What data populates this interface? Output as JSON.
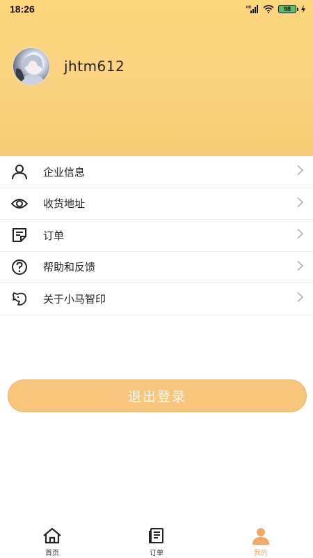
{
  "status_bar": {
    "time": "18:26",
    "battery": "98"
  },
  "profile": {
    "username": "jhtm612"
  },
  "menu": {
    "items": [
      {
        "label": "企业信息",
        "icon": "person-icon"
      },
      {
        "label": "收货地址",
        "icon": "eye-icon"
      },
      {
        "label": "订单",
        "icon": "order-icon"
      },
      {
        "label": "帮助和反馈",
        "icon": "help-icon"
      },
      {
        "label": "关于小马智印",
        "icon": "horse-icon"
      }
    ]
  },
  "logout_label": "退出登录",
  "tabbar": {
    "tabs": [
      {
        "label": "首页",
        "icon": "home-icon",
        "active": false
      },
      {
        "label": "订单",
        "icon": "order-icon",
        "active": false
      },
      {
        "label": "我的",
        "icon": "profile-icon",
        "active": true
      }
    ]
  },
  "colors": {
    "header_gradient_top": "#fcd77c",
    "header_gradient_bottom": "#f8cb73",
    "logout_button": "#f7c67c",
    "active_tab": "#f1a869"
  }
}
